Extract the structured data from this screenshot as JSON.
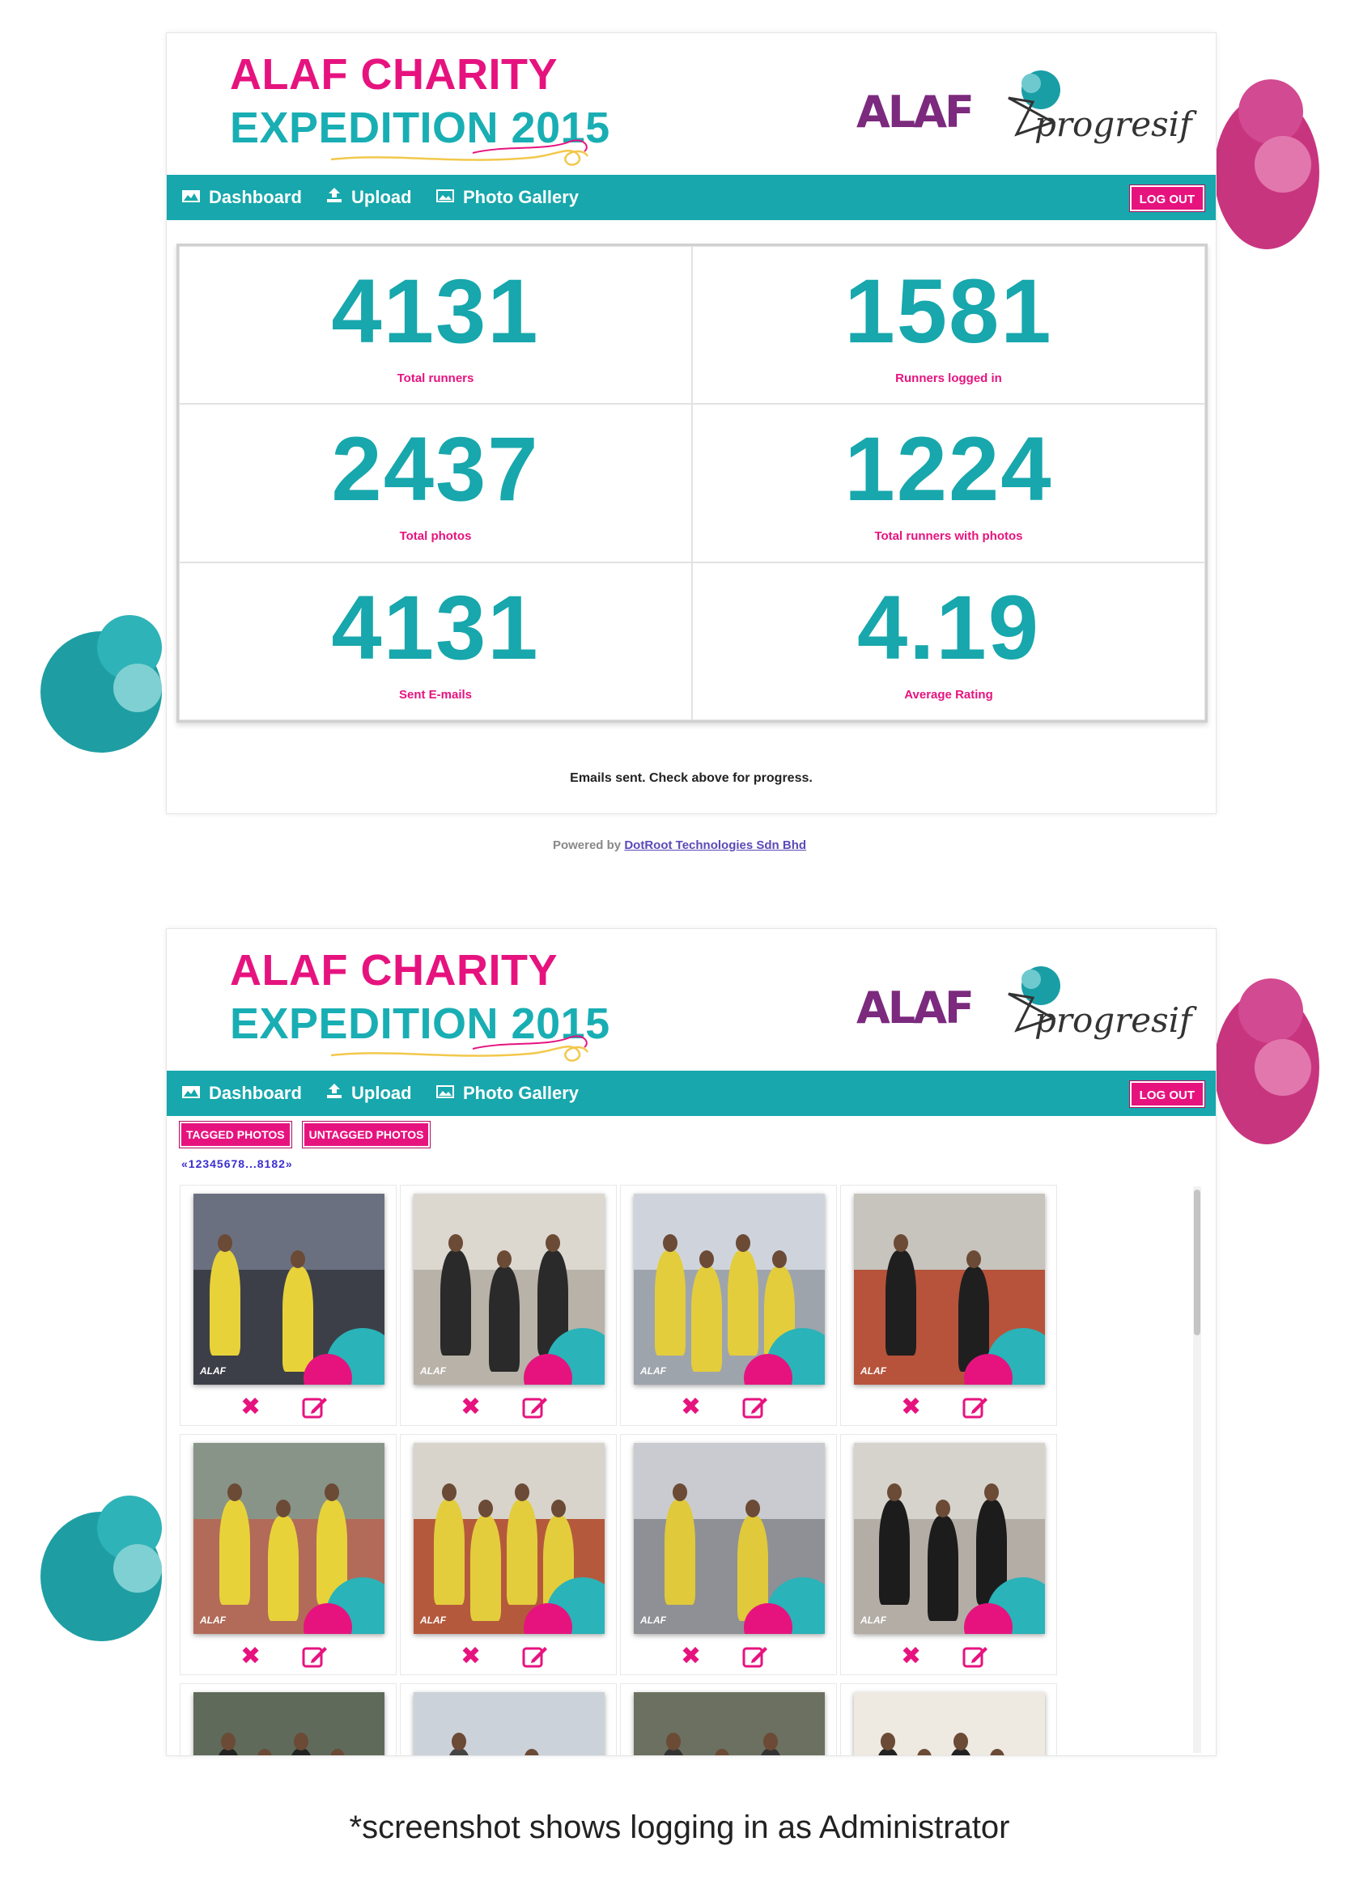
{
  "colors": {
    "pink": "#e6137f",
    "teal": "#17a7ac",
    "purple": "#7b2a7e"
  },
  "brand": {
    "title_line1": "ALAF CHARITY",
    "title_line2": "EXPEDITION 2015",
    "logo_alaf": "ALAF",
    "logo_progresif": "progresif"
  },
  "nav": {
    "items": [
      {
        "label": "Dashboard",
        "icon": "dashboard-icon"
      },
      {
        "label": "Upload",
        "icon": "upload-icon"
      },
      {
        "label": "Photo Gallery",
        "icon": "photo-gallery-icon"
      }
    ],
    "logout": "LOG OUT"
  },
  "dashboard": {
    "stats": [
      {
        "value": "4131",
        "label": "Total runners"
      },
      {
        "value": "1581",
        "label": "Runners logged in"
      },
      {
        "value": "2437",
        "label": "Total photos"
      },
      {
        "value": "1224",
        "label": "Total runners with photos"
      },
      {
        "value": "4131",
        "label": "Sent E-mails"
      },
      {
        "value": "4.19",
        "label": "Average Rating"
      }
    ],
    "message": "Emails sent. Check above for progress."
  },
  "footer": {
    "powered_prefix": "Powered by",
    "powered_link": "DotRoot Technologies Sdn Bhd"
  },
  "gallery": {
    "tagged_label": "TAGGED PHOTOS",
    "untagged_label": "UNTAGGED PHOTOS",
    "pagination": "«12345678...8182»",
    "delete_icon": "delete-icon",
    "edit_icon": "edit-icon",
    "photo_watermark": "ALAF"
  },
  "caption": "*screenshot shows logging in as Administrator"
}
